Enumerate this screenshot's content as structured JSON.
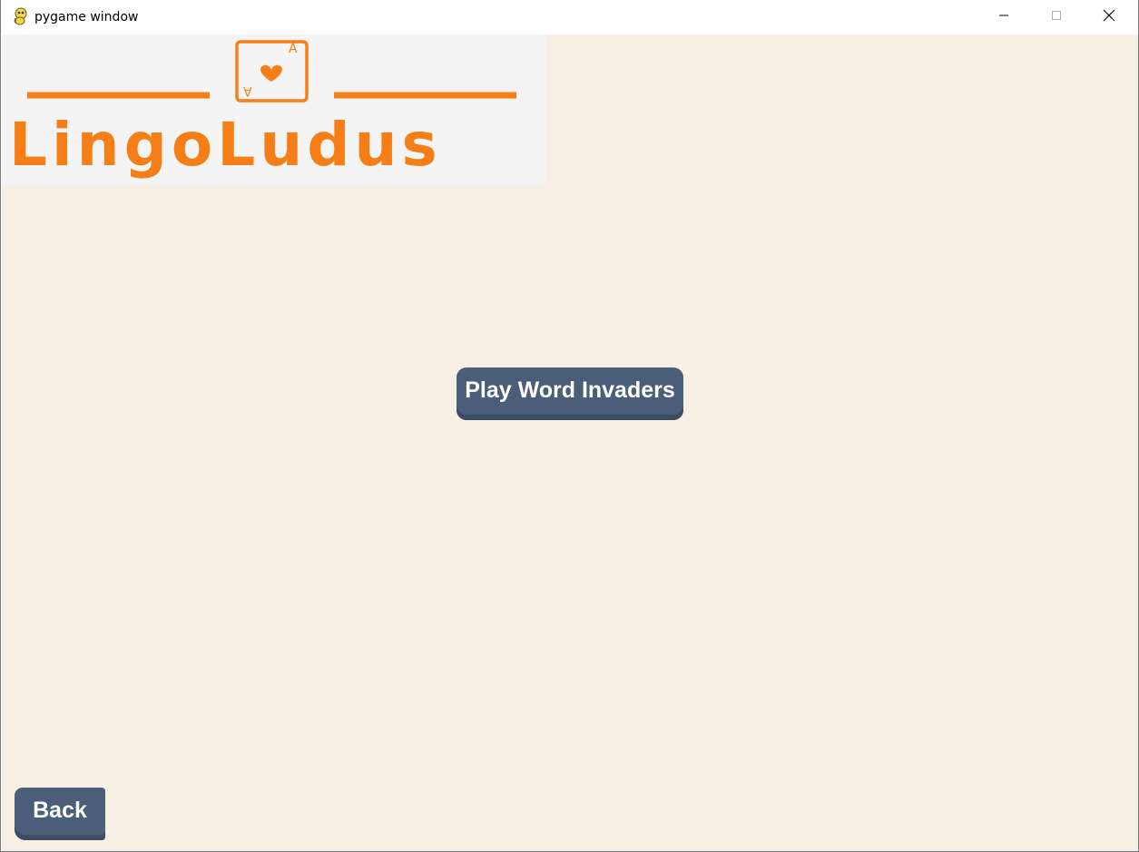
{
  "window": {
    "title": "pygame window",
    "app_icon": "pygame-snake-icon",
    "controls": {
      "minimize_icon": "minimize-icon",
      "maximize_icon": "maximize-icon",
      "close_icon": "close-icon"
    }
  },
  "logo": {
    "text": "LingoLudus",
    "card_rank": "A",
    "card_suit_icon": "heart-icon",
    "color": "#f57f16"
  },
  "menu": {
    "play_button_label": "Play Word Invaders",
    "back_button_label": "Back"
  },
  "colors": {
    "background": "#f7efe4",
    "logo_panel": "#f4f4f4",
    "button": "#4a5e7a",
    "button_text": "#ffffff"
  }
}
